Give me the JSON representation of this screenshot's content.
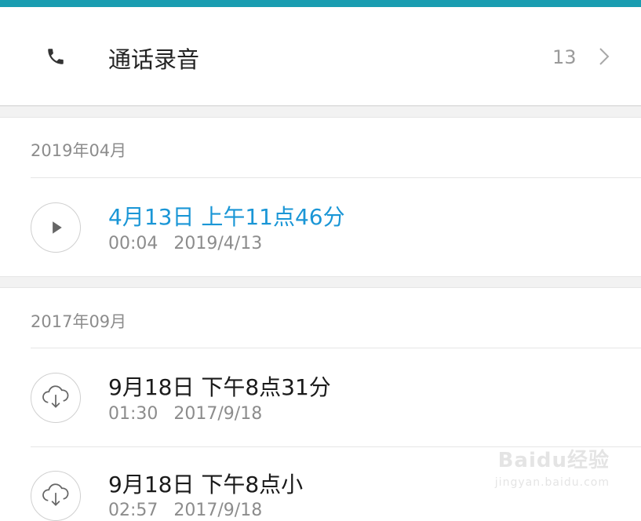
{
  "header": {
    "title": "通话录音",
    "count": "13"
  },
  "groups": [
    {
      "label": "2019年04月",
      "records": [
        {
          "title": "4月13日 上午11点46分",
          "duration": "00:04",
          "date": "2019/4/13",
          "icon": "play-icon"
        }
      ]
    },
    {
      "label": "2017年09月",
      "records": [
        {
          "title": "9月18日 下午8点31分",
          "duration": "01:30",
          "date": "2017/9/18",
          "icon": "cloud-download-icon"
        },
        {
          "title": "9月18日 下午8点小",
          "duration": "02:57",
          "date": "2017/9/18",
          "icon": "cloud-download-icon"
        }
      ]
    }
  ],
  "watermark": {
    "brand": "Baidu经验",
    "url": "jingyan.baidu.com"
  },
  "colors": {
    "topbar": "#1a9db1",
    "active_title": "#1a96d6"
  }
}
